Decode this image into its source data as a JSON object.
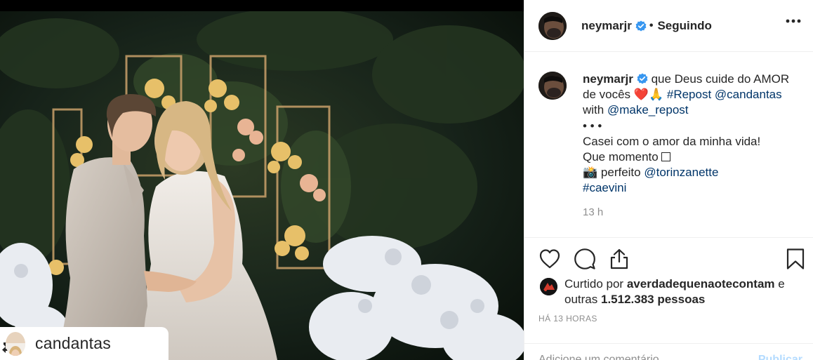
{
  "post": {
    "repost_tag_name": "candantas"
  },
  "header": {
    "username": "neymarjr",
    "separator": "•",
    "follow_status": "Seguindo"
  },
  "caption": {
    "username": "neymarjr",
    "line1_text": "que Deus cuide do AMOR",
    "line2_text": "de vocês",
    "line2_emoji": "❤️🙏",
    "hashtag_repost": "#Repost",
    "mention_candantas": "@candantas",
    "line3_text": "with",
    "mention_make_repost": "@make_repost",
    "dots": "• • •",
    "line5": "Casei com o amor da minha vida!",
    "line6": "Que momento",
    "line7_emoji": "📸",
    "line7_text": "perfeito",
    "mention_photographer": "@torinzanette",
    "hashtag_caevini": "#caevini",
    "time_ago": "13 h"
  },
  "actions": {
    "icons": [
      "heart-icon",
      "comment-icon",
      "share-icon",
      "bookmark-icon"
    ]
  },
  "likes": {
    "prefix": "Curtido por",
    "user": "averdadequenaotecontam",
    "suffix": "e",
    "others_prefix": "outras",
    "count": "1.512.383 pessoas"
  },
  "posted": "HÁ 13 HORAS",
  "comment_box": {
    "placeholder": "Adicione um comentário...",
    "publish_label": "Publicar"
  },
  "colors": {
    "link": "#003569",
    "muted": "#8e8e8e",
    "verified": "#3897f0",
    "publish_disabled": "#b3dbff",
    "heart": "#e0245e"
  }
}
